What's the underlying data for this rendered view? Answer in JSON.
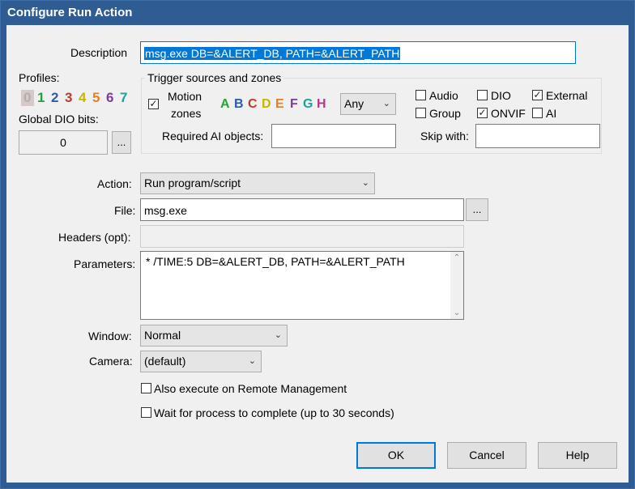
{
  "window": {
    "title": "Configure Run Action"
  },
  "description": {
    "label": "Description",
    "value": "msg.exe DB=&ALERT_DB, PATH=&ALERT_PATH"
  },
  "profiles": {
    "label": "Profiles:",
    "digits": [
      {
        "text": "0",
        "color": "#b0b0b0"
      },
      {
        "text": "1",
        "color": "#2e9e3a"
      },
      {
        "text": "2",
        "color": "#2a5db0"
      },
      {
        "text": "3",
        "color": "#c0392b"
      },
      {
        "text": "4",
        "color": "#c9b400"
      },
      {
        "text": "5",
        "color": "#e67e22"
      },
      {
        "text": "6",
        "color": "#7d3c98"
      },
      {
        "text": "7",
        "color": "#1aa39a"
      }
    ]
  },
  "global_dio": {
    "label": "Global DIO bits:",
    "value": "0",
    "button": "..."
  },
  "trigger": {
    "title": "Trigger sources and zones",
    "motion_label_1": "Motion",
    "motion_label_2": "zones",
    "motion_checked": "✓",
    "zones": [
      {
        "text": "A",
        "color": "#2e9e3a"
      },
      {
        "text": "B",
        "color": "#2a5db0"
      },
      {
        "text": "C",
        "color": "#c0392b"
      },
      {
        "text": "D",
        "color": "#c9b400"
      },
      {
        "text": "E",
        "color": "#e67e22"
      },
      {
        "text": "F",
        "color": "#7d3c98"
      },
      {
        "text": "G",
        "color": "#1aa39a"
      },
      {
        "text": "H",
        "color": "#b03a8c"
      }
    ],
    "any_select": "Any",
    "checks": {
      "audio": {
        "label": "Audio",
        "mark": ""
      },
      "dio": {
        "label": "DIO",
        "mark": ""
      },
      "external": {
        "label": "External",
        "mark": "✓"
      },
      "group": {
        "label": "Group",
        "mark": ""
      },
      "onvif": {
        "label": "ONVIF",
        "mark": "✓"
      },
      "ai": {
        "label": "AI",
        "mark": ""
      }
    },
    "required_ai_label": "Required AI objects:",
    "required_ai_value": "",
    "skip_with_label": "Skip with:",
    "skip_with_value": ""
  },
  "action": {
    "label": "Action:",
    "value": "Run program/script"
  },
  "file": {
    "label": "File:",
    "value": "msg.exe",
    "button": "..."
  },
  "headers": {
    "label": "Headers (opt):",
    "value": ""
  },
  "parameters": {
    "label": "Parameters:",
    "value": "* /TIME:5 DB=&ALERT_DB, PATH=&ALERT_PATH"
  },
  "window_mode": {
    "label": "Window:",
    "value": "Normal"
  },
  "camera": {
    "label": "Camera:",
    "value": "(default)"
  },
  "options": {
    "remote": {
      "label": "Also execute on Remote Management",
      "mark": ""
    },
    "wait": {
      "label": "Wait for process to complete (up to 30 seconds)",
      "mark": ""
    }
  },
  "buttons": {
    "ok": "OK",
    "cancel": "Cancel",
    "help": "Help"
  }
}
